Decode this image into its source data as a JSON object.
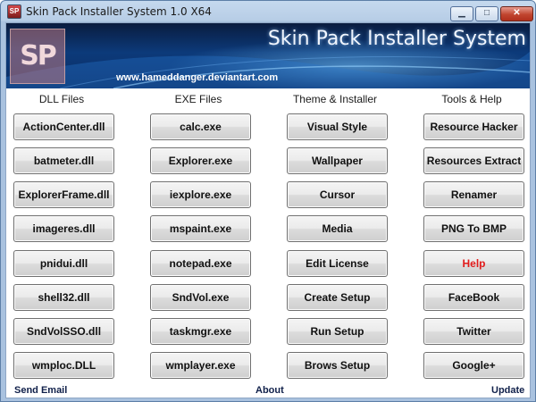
{
  "window": {
    "title": "Skin Pack Installer System 1.0 X64",
    "minimize_glyph": "▁",
    "maximize_glyph": "□",
    "close_glyph": "✕",
    "app_icon_text": "SP"
  },
  "banner": {
    "logo_text": "SP",
    "title": "Skin Pack Installer System",
    "url": "www.hameddanger.deviantart.com"
  },
  "columns": [
    {
      "header": "DLL Files",
      "buttons": [
        "ActionCenter.dll",
        "batmeter.dll",
        "ExplorerFrame.dll",
        "imageres.dll",
        "pnidui.dll",
        "shell32.dll",
        "SndVolSSO.dll",
        "wmploc.DLL"
      ]
    },
    {
      "header": "EXE Files",
      "buttons": [
        "calc.exe",
        "Explorer.exe",
        "iexplore.exe",
        "mspaint.exe",
        "notepad.exe",
        "SndVol.exe",
        "taskmgr.exe",
        "wmplayer.exe"
      ]
    },
    {
      "header": "Theme & Installer",
      "buttons": [
        "Visual Style",
        "Wallpaper",
        "Cursor",
        "Media",
        "Edit License",
        "Create Setup",
        "Run Setup",
        "Brows Setup"
      ]
    },
    {
      "header": "Tools & Help",
      "buttons": [
        "Resource Hacker",
        "Resources Extract",
        "Renamer",
        "PNG To BMP",
        "Help",
        "FaceBook",
        "Twitter",
        "Google+"
      ]
    }
  ],
  "footer": {
    "send_email": "Send Email",
    "about": "About",
    "update": "Update"
  },
  "colors": {
    "help_text": "#e11b1b",
    "banner_dark": "#0a1c3f",
    "banner_mid": "#0c3a7a"
  }
}
